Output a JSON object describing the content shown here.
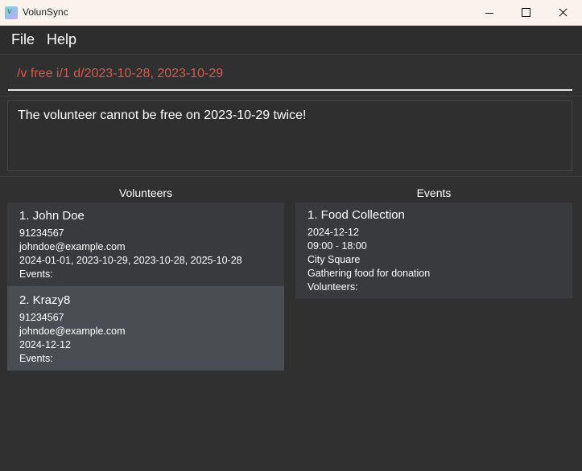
{
  "window": {
    "title": "VolunSync",
    "icon": "app-logo-icon"
  },
  "menu": {
    "file": "File",
    "help": "Help"
  },
  "command": {
    "value": "/v free i/1 d/2023-10-28, 2023-10-29"
  },
  "result": {
    "message": "The volunteer cannot be free on 2023-10-29 twice!"
  },
  "volunteers": {
    "heading": "Volunteers",
    "items": [
      {
        "title": "1. John Doe",
        "phone": "91234567",
        "email": "johndoe@example.com",
        "dates": "2024-01-01, 2023-10-29, 2023-10-28, 2025-10-28",
        "events": "Events:"
      },
      {
        "title": "2. Krazy8",
        "phone": "91234567",
        "email": "johndoe@example.com",
        "dates": "2024-12-12",
        "events": "Events:"
      }
    ]
  },
  "events": {
    "heading": "Events",
    "items": [
      {
        "title": "1. Food Collection",
        "date": "2024-12-12",
        "time": "09:00 - 18:00",
        "location": "City Square",
        "description": "Gathering food for donation",
        "volunteers": "Volunteers:"
      }
    ]
  },
  "colors": {
    "background": "#303030",
    "command_text": "#d35a4a",
    "card": "#393a3d",
    "card_selected": "#4a4e52"
  }
}
